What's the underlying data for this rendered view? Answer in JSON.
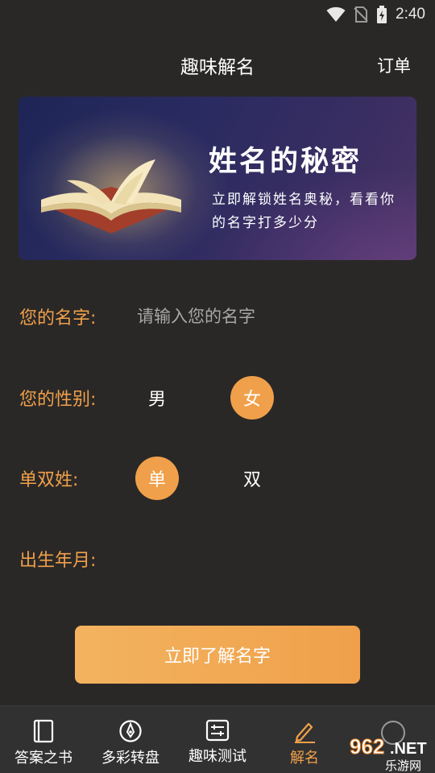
{
  "status_bar": {
    "time": "2:40"
  },
  "header": {
    "title": "趣味解名",
    "orders_label": "订单"
  },
  "banner": {
    "heading": "姓名的秘密",
    "subtext": "立即解锁姓名奥秘，看看你的名字打多少分"
  },
  "form": {
    "name": {
      "label": "您的名字:",
      "placeholder": "请输入您的名字",
      "value": ""
    },
    "gender": {
      "label": "您的性别:",
      "options": [
        "男",
        "女"
      ],
      "selected": "女"
    },
    "surname_type": {
      "label": "单双姓:",
      "options": [
        "单",
        "双"
      ],
      "selected": "单"
    },
    "birth": {
      "label": "出生年月:",
      "value": ""
    },
    "submit_label": "立即了解名字"
  },
  "tabs": [
    {
      "label": "答案之书",
      "icon": "book-icon",
      "active": false
    },
    {
      "label": "多彩转盘",
      "icon": "compass-icon",
      "active": false
    },
    {
      "label": "趣味测试",
      "icon": "test-list-icon",
      "active": false
    },
    {
      "label": "解名",
      "icon": "pen-icon",
      "active": true
    }
  ],
  "watermark": {
    "text": "962.NET",
    "subtext": "乐游网"
  },
  "colors": {
    "accent": "#f0a04a",
    "background": "#2a2827",
    "tabbar": "#323131"
  }
}
